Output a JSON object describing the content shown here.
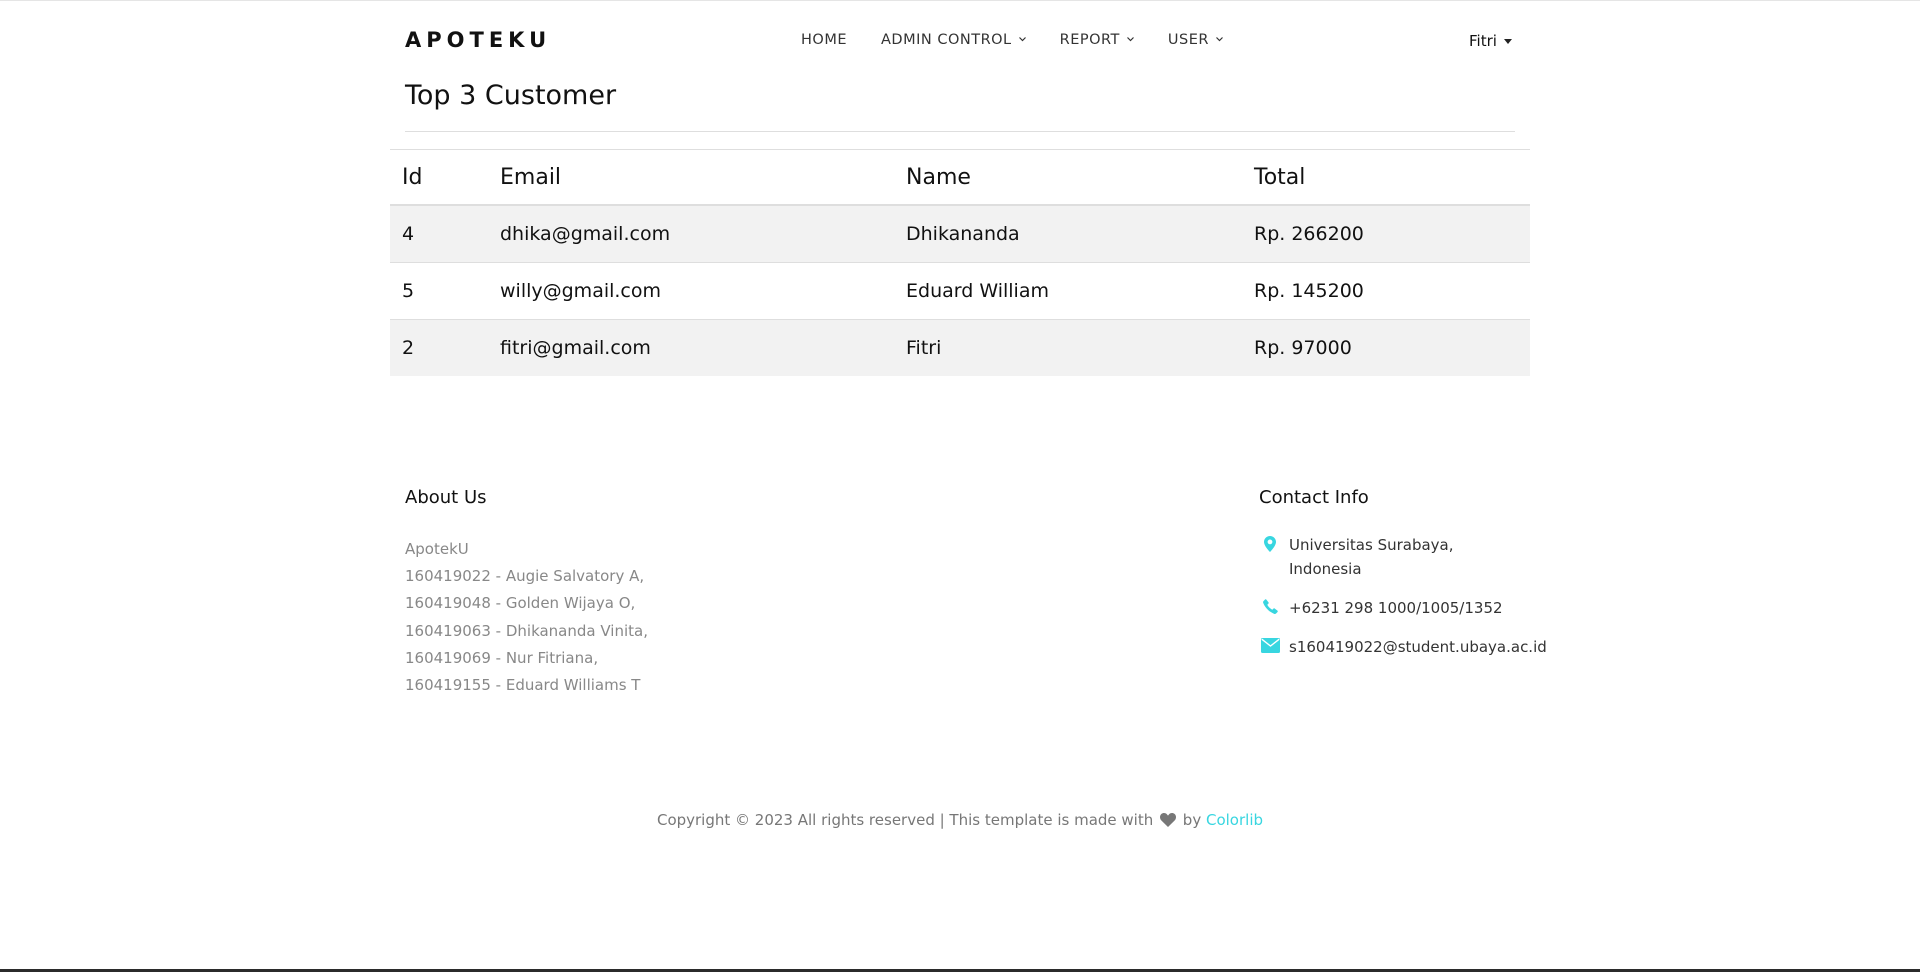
{
  "brand": "APOTEKU",
  "nav": [
    {
      "label": "HOME",
      "dropdown": false
    },
    {
      "label": "ADMIN CONTROL",
      "dropdown": true
    },
    {
      "label": "REPORT",
      "dropdown": true
    },
    {
      "label": "USER",
      "dropdown": true
    }
  ],
  "user_menu": "Fitri",
  "page_title": "Top 3 Customer",
  "table": {
    "headers": [
      "Id",
      "Email",
      "Name",
      "Total"
    ],
    "rows": [
      [
        "4",
        "dhika@gmail.com",
        "Dhikananda",
        "Rp. 266200"
      ],
      [
        "5",
        "willy@gmail.com",
        "Eduard William",
        "Rp. 145200"
      ],
      [
        "2",
        "fitri@gmail.com",
        "Fitri",
        "Rp. 97000"
      ]
    ]
  },
  "footer": {
    "about_title": "About Us",
    "about_lines": [
      "ApotekU",
      "160419022 - Augie Salvatory A,",
      "160419048 - Golden Wijaya O,",
      "160419063 - Dhikananda Vinita,",
      "160419069 - Nur Fitriana,",
      "160419155 - Eduard Williams T"
    ],
    "contact_title": "Contact Info",
    "contacts": [
      {
        "icon": "map-pin-icon",
        "lines": [
          "Universitas Surabaya,",
          "Indonesia"
        ]
      },
      {
        "icon": "phone-icon",
        "lines": [
          "+6231 298 1000/1005/1352"
        ]
      },
      {
        "icon": "envelope-icon",
        "lines": [
          "s160419022@student.ubaya.ac.id"
        ]
      }
    ],
    "copyright_prefix": "Copyright © 2023 All rights reserved | This template is made with",
    "copyright_by": "by",
    "copyright_link": "Colorlib"
  },
  "colors": {
    "accent": "#38d6e0",
    "muted_text": "#888888",
    "striped_row": "#f2f2f2"
  }
}
